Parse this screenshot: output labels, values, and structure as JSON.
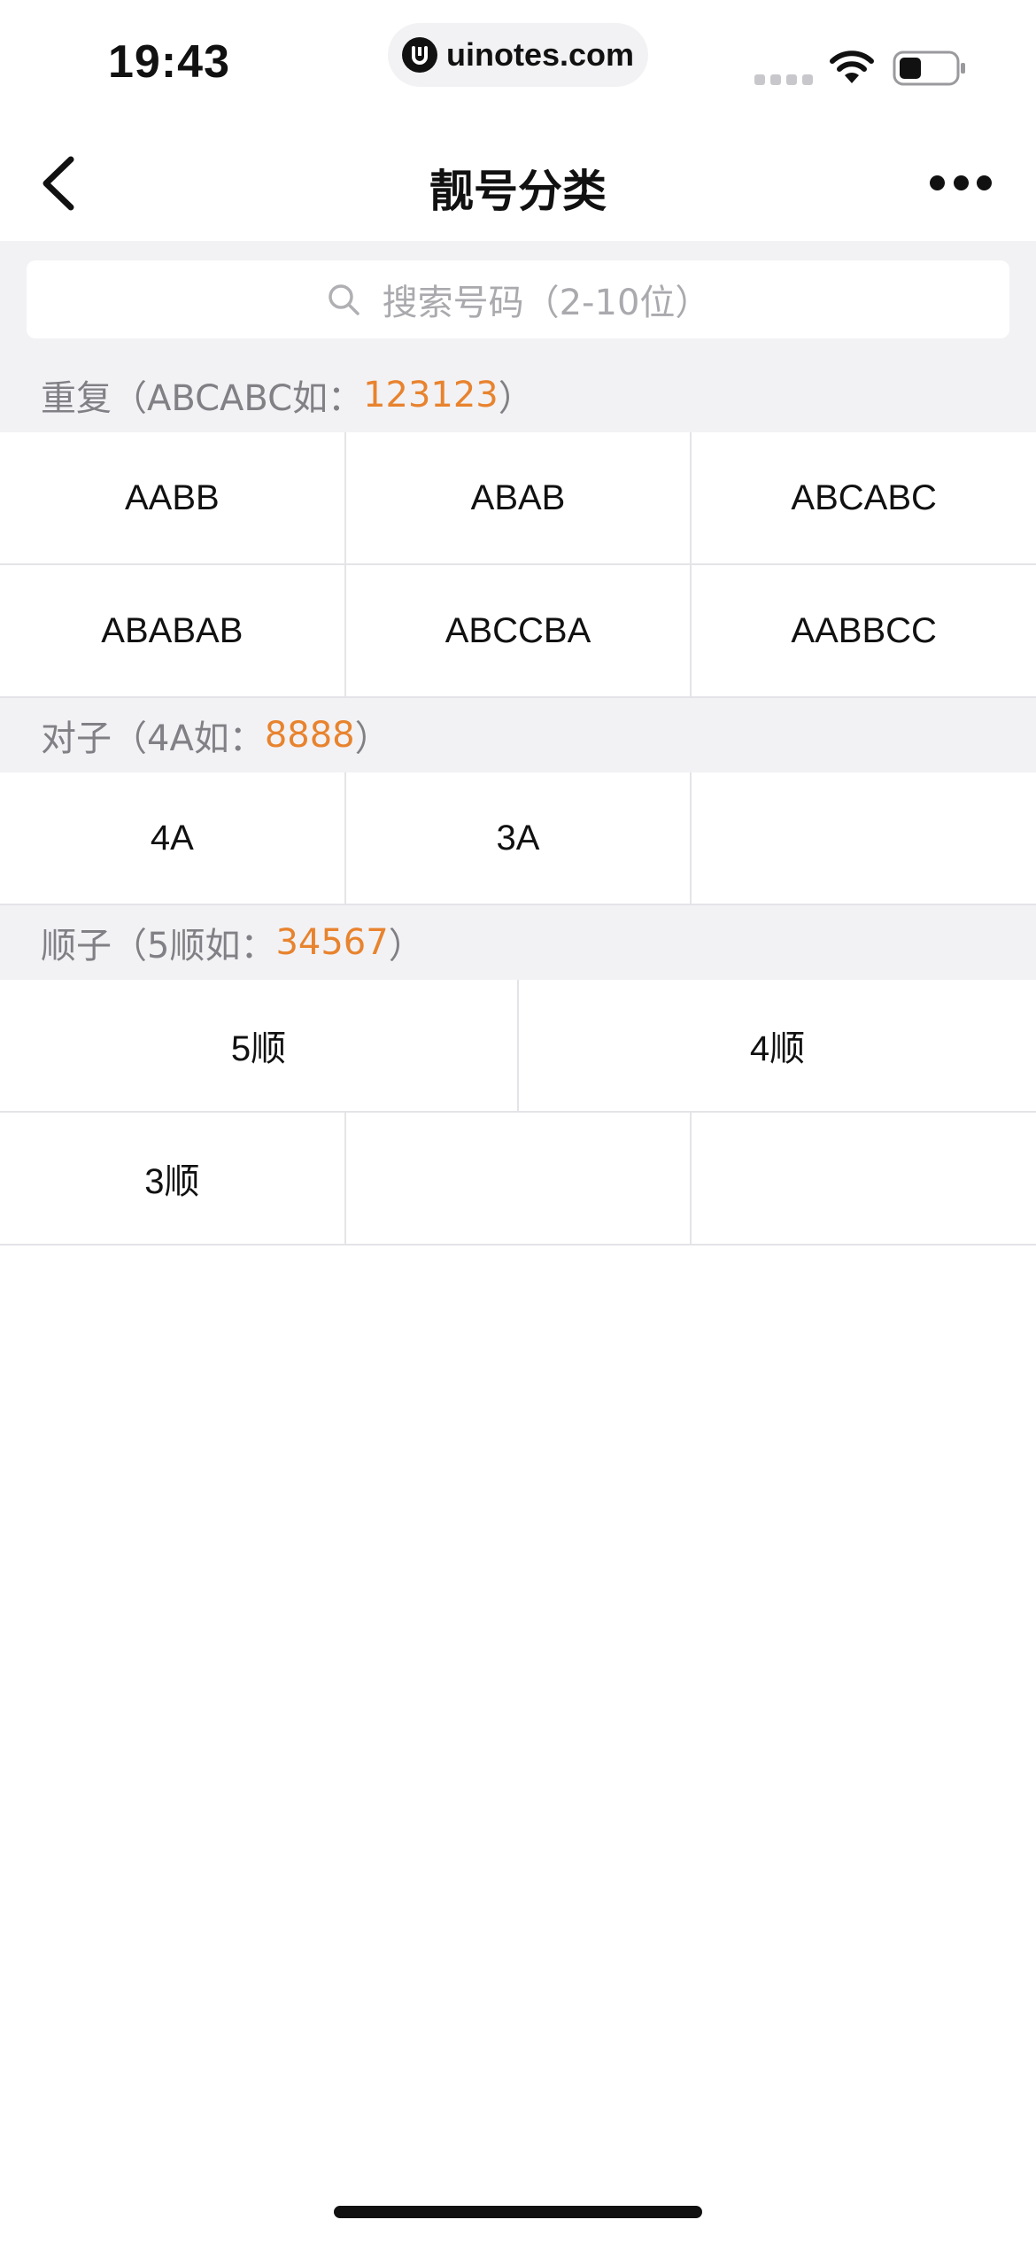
{
  "status_bar": {
    "time": "19:43",
    "url": "uinotes.com"
  },
  "nav": {
    "title": "靓号分类"
  },
  "search": {
    "placeholder": "搜索号码（2-10位）"
  },
  "sections": [
    {
      "label_prefix": "重复（ABCABC如：",
      "example": "123123",
      "label_suffix": "）",
      "rows": [
        [
          "AABB",
          "ABAB",
          "ABCABC"
        ],
        [
          "ABABAB",
          "ABCCBA",
          "AABBCC"
        ]
      ]
    },
    {
      "label_prefix": "对子（4A如：",
      "example": "8888",
      "label_suffix": "）",
      "rows": [
        [
          "4A",
          "3A",
          ""
        ]
      ]
    },
    {
      "label_prefix": "顺子（5顺如：",
      "example": "34567",
      "label_suffix": "）",
      "rows": [
        [
          "5顺",
          "4顺"
        ],
        [
          "3顺",
          "",
          ""
        ]
      ]
    }
  ],
  "colors": {
    "accent": "#e8832e",
    "section_bg": "#f2f2f5",
    "divider": "#e4e4e8"
  },
  "icons": {
    "back": "chevron-left-icon",
    "more": "more-dots-icon",
    "search": "search-icon",
    "wifi": "wifi-icon",
    "battery": "battery-icon"
  }
}
